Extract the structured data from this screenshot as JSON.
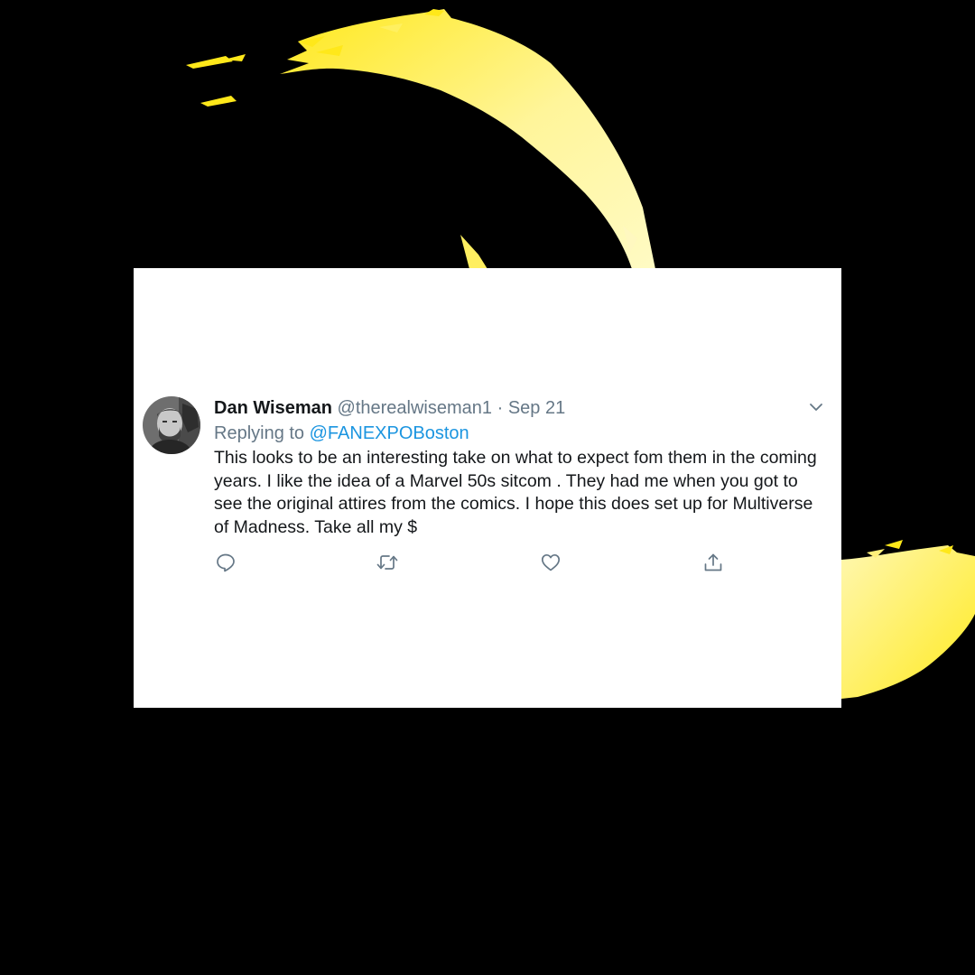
{
  "colors": {
    "background": "#000000",
    "brush_yellow": "#ffe81a",
    "brush_highlight": "#fffbb0",
    "card": "#ffffff",
    "text_primary": "#14171a",
    "text_secondary": "#657786",
    "link": "#1b95e0"
  },
  "tweet": {
    "display_name": "Dan Wiseman",
    "handle": "@therealwiseman1",
    "separator": "·",
    "date": "Sep 21",
    "replying_to_prefix": "Replying to",
    "replying_to_handle": "@FANEXPOBoston",
    "text": "This looks to be an interesting take on what to expect fom them in the coming years. I like the idea of a Marvel 50s sitcom . They had me when you got to see the original attires from the comics. I hope this does set up for Multiverse of Madness. Take all my $",
    "avatar_icon": "user-photo",
    "menu_icon": "chevron-down-icon",
    "actions": [
      {
        "name": "reply",
        "icon": "reply-icon"
      },
      {
        "name": "retweet",
        "icon": "retweet-icon"
      },
      {
        "name": "like",
        "icon": "heart-icon"
      },
      {
        "name": "share",
        "icon": "share-icon"
      }
    ]
  }
}
